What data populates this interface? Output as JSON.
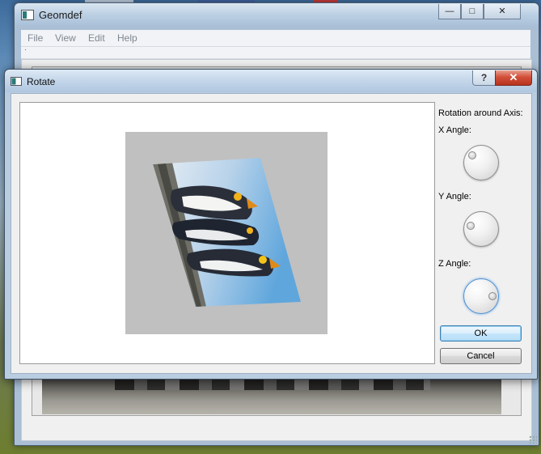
{
  "main_window": {
    "title": "Geomdef",
    "menu": [
      "File",
      "View",
      "Edit",
      "Help"
    ],
    "toolbar_text": "·"
  },
  "dialog": {
    "title": "Rotate",
    "help_label": "?",
    "close_label": "✕",
    "axis_title": "Rotation around Axis:",
    "x_angle_label": "X Angle:",
    "y_angle_label": "Y Angle:",
    "z_angle_label": "Z Angle:",
    "ok_label": "OK",
    "cancel_label": "Cancel"
  },
  "window_controls": {
    "minimize": "—",
    "maximize": "□",
    "close": "✕"
  },
  "colors": {
    "accent_focus": "#4f8fd2",
    "close_red": "#d2503a",
    "canvas_gray": "#c0c0c0"
  }
}
